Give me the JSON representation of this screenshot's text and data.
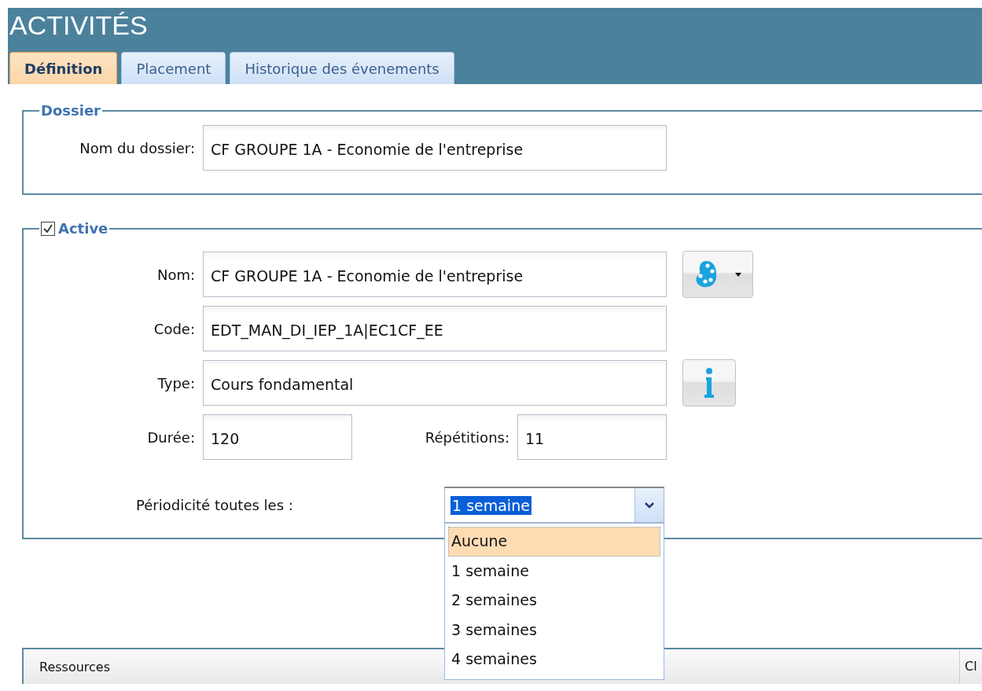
{
  "window": {
    "title": "ACTIVITÉS"
  },
  "tabs": [
    {
      "label": "Définition",
      "selected": true
    },
    {
      "label": "Placement",
      "selected": false
    },
    {
      "label": "Historique des évenements",
      "selected": false
    }
  ],
  "dossier": {
    "legend": "Dossier",
    "label": "Nom du dossier:",
    "value": "CF GROUPE 1A - Economie de l'entreprise"
  },
  "active": {
    "legend": "Active",
    "checked": true,
    "fields": [
      {
        "label": "Nom:",
        "value": "CF GROUPE 1A - Economie de l'entreprise",
        "button": {
          "kind": "palette"
        }
      },
      {
        "label": "Code:",
        "value": "EDT_MAN_DI_IEP_1A|EC1CF_EE"
      },
      {
        "label": "Type:",
        "value": "Cours fondamental",
        "button": {
          "kind": "info"
        }
      }
    ],
    "duree": {
      "label": "Durée:",
      "value": "120"
    },
    "repetitions": {
      "label": "Répétitions:",
      "value": "11"
    },
    "periodicite": {
      "label": "Périodicité toutes les :",
      "value": "1 semaine",
      "highlighted": true,
      "expanded": true,
      "options": [
        {
          "label": "Aucune",
          "highlighted": true
        },
        {
          "label": "1 semaine",
          "highlighted": false
        },
        {
          "label": "2 semaines",
          "highlighted": false
        },
        {
          "label": "3 semaines",
          "highlighted": false
        },
        {
          "label": "4 semaines",
          "highlighted": false
        }
      ]
    }
  },
  "table": {
    "columns": [
      "Ressources",
      "Cl"
    ]
  }
}
